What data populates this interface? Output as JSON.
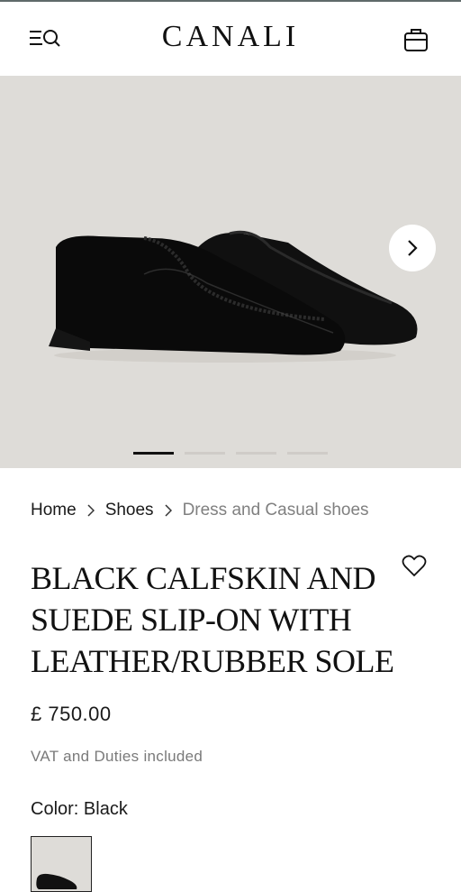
{
  "header": {
    "brand": "CANALI",
    "menu_icon": "menu-search-icon",
    "bag_icon": "shopping-bag-icon"
  },
  "gallery": {
    "slide_count": 4,
    "active_slide": 1,
    "next_icon": "chevron-right-icon",
    "image_subject": "black leather slip-on loafers"
  },
  "breadcrumb": {
    "items": [
      "Home",
      "Shoes",
      "Dress and Casual shoes"
    ]
  },
  "product": {
    "title": "BLACK CALFSKIN AND SUEDE SLIP-ON WITH LEATHER/RUBBER SOLE",
    "price": "£ 750.00",
    "vat_note": "VAT and Duties included",
    "color_label": "Color: Black",
    "wishlist_icon": "heart-icon"
  },
  "colors": {
    "hero_bg": "#dedcd8",
    "active_dot": "#111111",
    "inactive_dot": "#cfccc8",
    "muted_text": "#808080"
  }
}
